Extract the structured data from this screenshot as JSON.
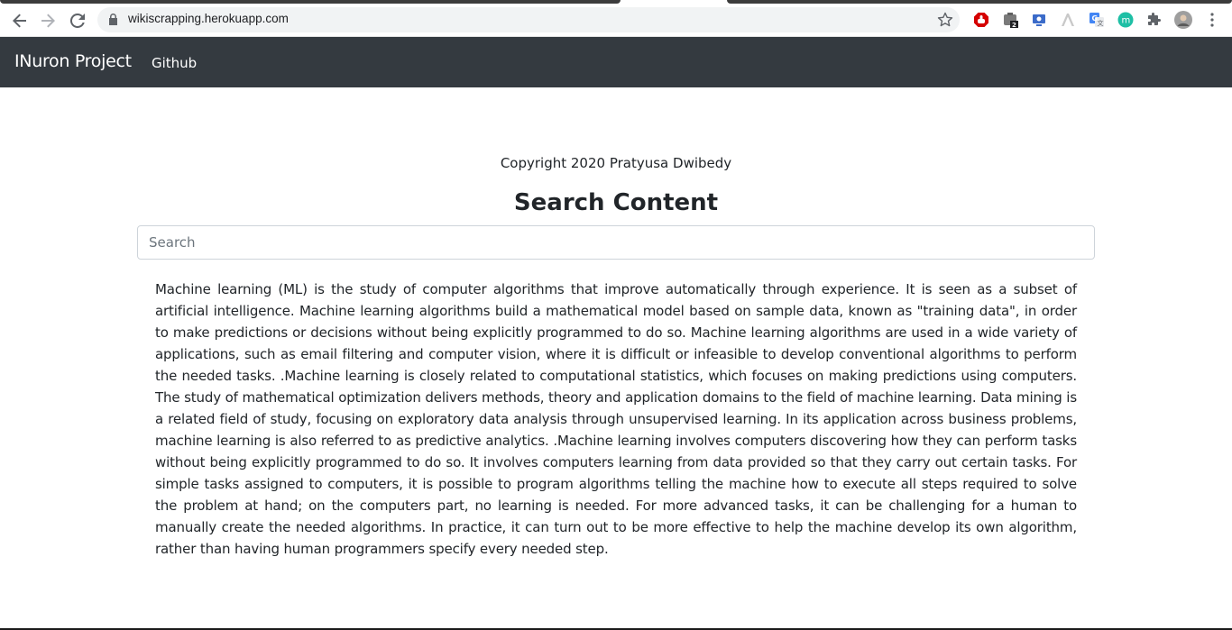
{
  "browser": {
    "url": "wikiscrapping.herokuapp.com",
    "extension_badge": "2",
    "extensions": [
      "ublock-icon",
      "briefcase-icon",
      "screen-capture-icon",
      "read-aloud-icon",
      "translate-icon",
      "m-extension-icon",
      "puzzle-icon"
    ],
    "ext_letter": "m"
  },
  "navbar": {
    "brand": "INuron Project",
    "link": "Github"
  },
  "content": {
    "copyright": "Copyright 2020 Pratyusa Dwibedy",
    "heading": "Search Content",
    "search_placeholder": "Search",
    "article": "Machine learning (ML) is the study of computer algorithms that improve automatically through experience. It is seen as a subset of artificial intelligence. Machine learning algorithms build a mathematical model based on sample data, known as \"training data\", in order to make predictions or decisions without being explicitly programmed to do so. Machine learning algorithms are used in a wide variety of applications, such as email filtering and computer vision, where it is difficult or infeasible to develop conventional algorithms to perform the needed tasks. .Machine learning is closely related to computational statistics, which focuses on making predictions using computers. The study of mathematical optimization delivers methods, theory and application domains to the field of machine learning. Data mining is a related field of study, focusing on exploratory data analysis through unsupervised learning. In its application across business problems, machine learning is also referred to as predictive analytics. .Machine learning involves computers discovering how they can perform tasks without being explicitly programmed to do so. It involves computers learning from data provided so that they carry out certain tasks. For simple tasks assigned to computers, it is possible to program algorithms telling the machine how to execute all steps required to solve the problem at hand; on the computers part, no learning is needed. For more advanced tasks, it can be challenging for a human to manually create the needed algorithms. In practice, it can turn out to be more effective to help the machine develop its own algorithm, rather than having human programmers specify every needed step."
  },
  "colors": {
    "navbar_bg": "#343a40",
    "text": "#212529"
  }
}
